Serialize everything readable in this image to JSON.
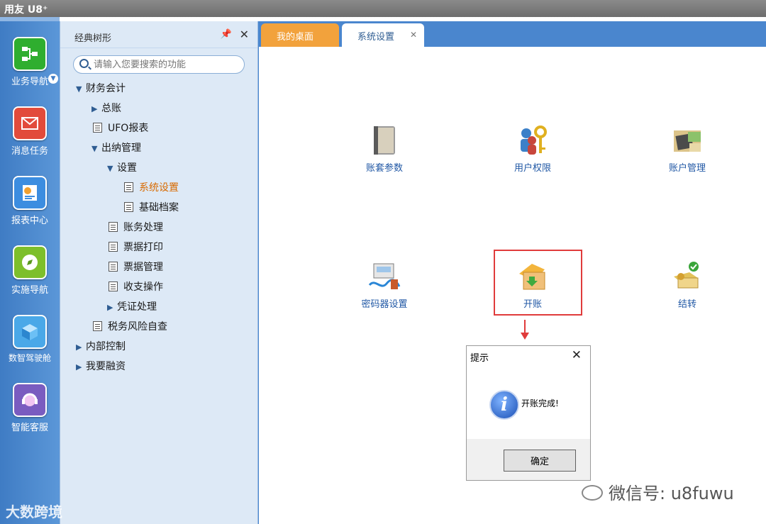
{
  "titlebar": {
    "app_title": "用友 U8⁺"
  },
  "leftnav": {
    "items": [
      {
        "label": "业务导航",
        "icon": "business-nav-icon",
        "color": "#2fae2f"
      },
      {
        "label": "消息任务",
        "icon": "message-icon",
        "color": "#e24b3b"
      },
      {
        "label": "报表中心",
        "icon": "report-icon",
        "color": "#3c8de0"
      },
      {
        "label": "实施导航",
        "icon": "compass-icon",
        "color": "#7dbf2b"
      },
      {
        "label": "数智驾驶舱",
        "icon": "cockpit-icon",
        "color": "#4aa8e8"
      },
      {
        "label": "智能客服",
        "icon": "headset-icon",
        "color": "#7a5cc0"
      }
    ]
  },
  "tree": {
    "title": "经典树形",
    "search_placeholder": "请输入您要搜索的功能",
    "nodes": [
      {
        "label": "财务会计"
      },
      {
        "label": "总账"
      },
      {
        "label": "UFO报表"
      },
      {
        "label": "出纳管理"
      },
      {
        "label": "设置"
      },
      {
        "label": "系统设置"
      },
      {
        "label": "基础档案"
      },
      {
        "label": "账务处理"
      },
      {
        "label": "票据打印"
      },
      {
        "label": "票据管理"
      },
      {
        "label": "收支操作"
      },
      {
        "label": "凭证处理"
      },
      {
        "label": "税务风险自查"
      },
      {
        "label": "内部控制"
      },
      {
        "label": "我要融资"
      }
    ]
  },
  "tabs": {
    "home": "我的桌面",
    "current": "系统设置"
  },
  "functions": [
    {
      "label": "账套参数"
    },
    {
      "label": "用户权限"
    },
    {
      "label": "账户管理"
    },
    {
      "label": "密码器设置"
    },
    {
      "label": "开账"
    },
    {
      "label": "结转"
    }
  ],
  "dialog": {
    "title": "提示",
    "message": "开账完成!",
    "ok_label": "确定"
  },
  "watermarks": {
    "left": "大数跨境",
    "right": "微信号: u8fuwu"
  }
}
